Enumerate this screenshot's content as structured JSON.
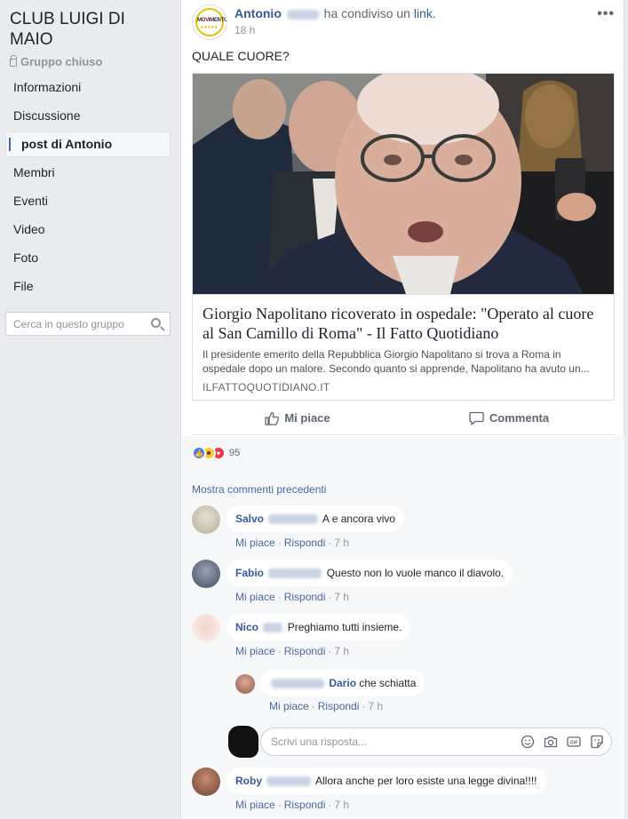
{
  "sidebar": {
    "group_title": "CLUB LUIGI DI MAIO",
    "group_type": "Gruppo chiuso",
    "items": [
      {
        "label": "Informazioni"
      },
      {
        "label": "Discussione"
      },
      {
        "label": "post di Antonio"
      },
      {
        "label": "Membri"
      },
      {
        "label": "Eventi"
      },
      {
        "label": "Video"
      },
      {
        "label": "Foto"
      },
      {
        "label": "File"
      }
    ],
    "active_index": 2,
    "search_placeholder": "Cerca in questo gruppo"
  },
  "post": {
    "author_first": "Antonio",
    "action_text": "ha condiviso un",
    "link_word": "link.",
    "time": "18 h",
    "more": "•••",
    "text": "QUALE CUORE?",
    "avatar_brand": "MOVIMENTO",
    "link": {
      "title": "Giorgio Napolitano ricoverato in ospedale: \"Operato al cuore al San Camillo di Roma\" - Il Fatto Quotidiano",
      "description": "Il presidente emerito della Repubblica Giorgio Napolitano si trova a Roma in ospedale dopo un malore. Secondo quanto si apprende, Napolitano ha avuto un...",
      "domain": "ILFATTOQUOTIDIANO.IT"
    },
    "actions": {
      "like": "Mi piace",
      "comment": "Commenta"
    },
    "reactions_count": "95",
    "prev_comments": "Mostra commenti precedenti"
  },
  "comment_meta": {
    "like": "Mi piace",
    "reply": "Rispondi",
    "sep": "·"
  },
  "comments": [
    {
      "name": "Salvo",
      "text": "A e ancora vivo",
      "time": "7 h"
    },
    {
      "name": "Fabio",
      "text": "Questo non lo vuole manco il diavolo.",
      "time": "7 h"
    },
    {
      "name": "Nico",
      "text": "Preghiamo tutti insieme.",
      "time": "7 h"
    },
    {
      "name": "Dario",
      "text": "che schiatta",
      "time": "7 h"
    },
    {
      "name": "Roby",
      "text": "Allora anche per loro esiste una legge divina!!!!",
      "time": "7 h"
    }
  ],
  "reply_box": {
    "placeholder": "Scrivi una risposta..."
  },
  "colors": {
    "link_blue": "#365899",
    "page_bg": "#e9ebee",
    "accent": "#4267b2"
  }
}
